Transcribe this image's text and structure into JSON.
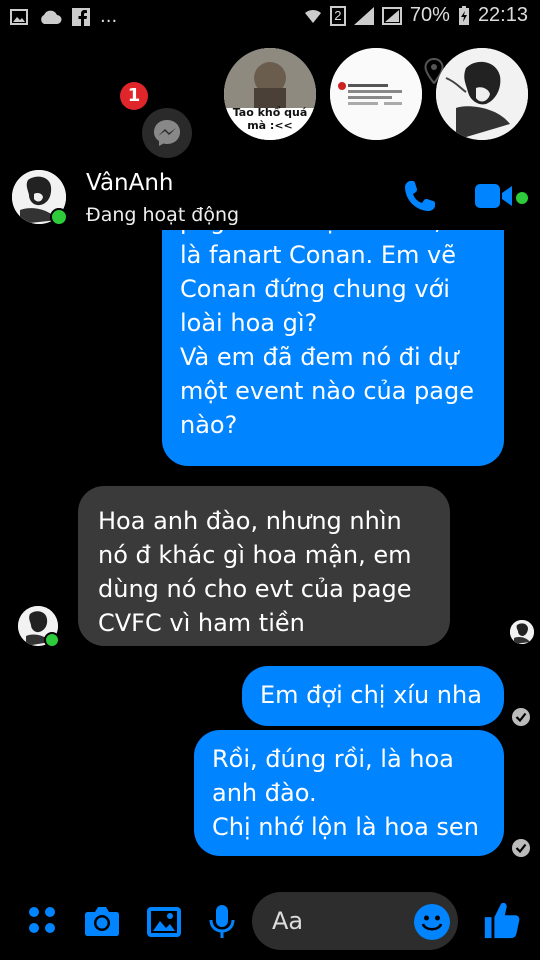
{
  "status_bar": {
    "battery_percent": "70%",
    "time": "22:13",
    "sim_number": "2",
    "more": "..."
  },
  "chat_heads": {
    "unread_count": "1",
    "items": [
      {
        "caption": "Tao khổ quá\nmà :<<"
      },
      {
        "caption": ""
      },
      {
        "caption": ""
      }
    ]
  },
  "header": {
    "contact_name": "VânAnh",
    "status": "Đang hoạt động"
  },
  "messages": [
    {
      "direction": "outgoing",
      "text": "page của chị là CCFC, đó\nlà fanart Conan. Em vẽ\nConan đứng chung với\nloài hoa gì?\nVà em đã đem nó đi dự\nmột event nào của page\nnào?"
    },
    {
      "direction": "incoming",
      "text": "Hoa anh đào, nhưng nhìn\nnó đ khác gì hoa mận, em\ndùng nó cho evt của page\nCVFC vì ham tiền"
    },
    {
      "direction": "outgoing",
      "text": "Em đợi chị xíu nha"
    },
    {
      "direction": "outgoing",
      "text": "Rồi, đúng rồi, là hoa\nanh đào.\nChị nhớ lộn là hoa sen"
    }
  ],
  "composer": {
    "placeholder": "Aa"
  },
  "colors": {
    "outgoing_bubble": "#0084ff",
    "incoming_bubble": "#3a3a3a",
    "accent": "#0084ff",
    "online": "#2ecc3a",
    "badge": "#e0262a"
  }
}
